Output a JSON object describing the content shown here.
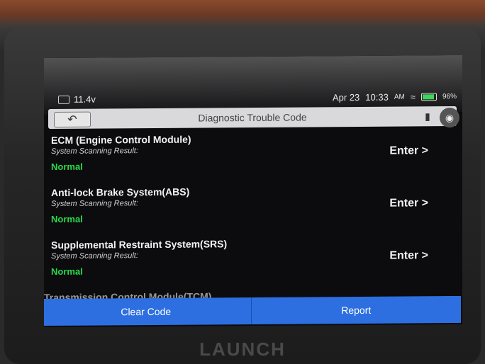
{
  "status_bar": {
    "voltage": "11.4v",
    "date": "Apr 23",
    "time": "10:33",
    "time_suffix": "AM",
    "battery": "96%"
  },
  "header": {
    "title": "Diagnostic Trouble Code",
    "back_icon": "back-arrow-icon",
    "camera_icon": "camera-icon"
  },
  "systems": [
    {
      "name": "ECM (Engine Control Module)",
      "subtitle": "System Scanning Result:",
      "status": "Normal",
      "action": "Enter >"
    },
    {
      "name": "Anti-lock Brake System(ABS)",
      "subtitle": "System Scanning Result:",
      "status": "Normal",
      "action": "Enter >"
    },
    {
      "name": "Supplemental Restraint System(SRS)",
      "subtitle": "System Scanning Result:",
      "status": "Normal",
      "action": "Enter >"
    }
  ],
  "cut_off_item": "Transmission Control Module(TCM)",
  "footer": {
    "clear_code": "Clear Code",
    "report": "Report"
  },
  "brand": "LAUNCH",
  "colors": {
    "accent": "#2d6fe0",
    "status_ok": "#27d84a",
    "screen_bg": "#0c0c0e"
  }
}
